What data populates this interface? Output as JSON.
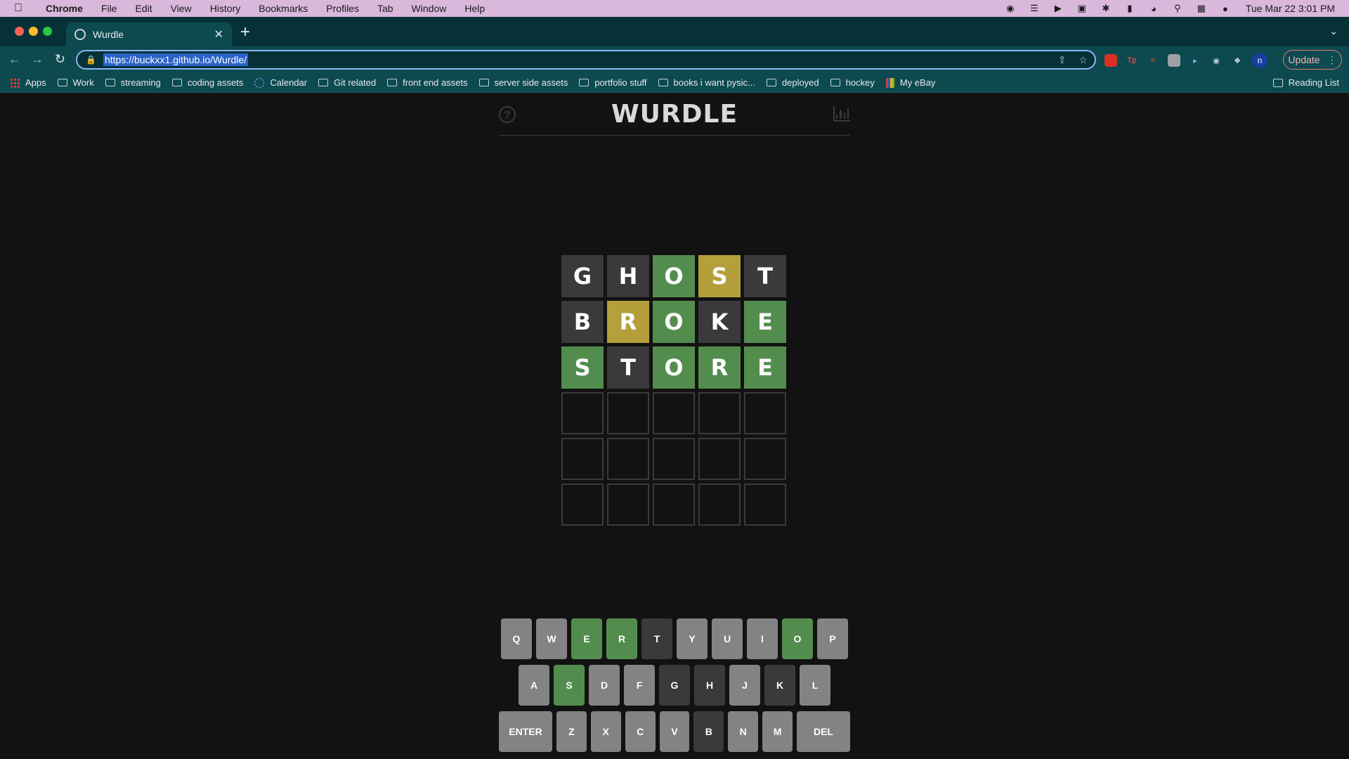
{
  "menubar": {
    "app": "Chrome",
    "items": [
      "File",
      "Edit",
      "View",
      "History",
      "Bookmarks",
      "Profiles",
      "Tab",
      "Window",
      "Help"
    ],
    "clock": "Tue Mar 22  3:01 PM"
  },
  "browser": {
    "tab_title": "Wurdle",
    "url": "https://buckxx1.github.io/Wurdle/",
    "update_label": "Update",
    "profile_initial": "n",
    "bookmarks": [
      {
        "label": "Apps",
        "icon": "apps-icon"
      },
      {
        "label": "Work",
        "icon": "folder-icon"
      },
      {
        "label": "streaming",
        "icon": "folder-icon"
      },
      {
        "label": "coding assets",
        "icon": "folder-icon"
      },
      {
        "label": "Calendar",
        "icon": "calendar-icon"
      },
      {
        "label": "Git related",
        "icon": "folder-icon"
      },
      {
        "label": "front end assets",
        "icon": "folder-icon"
      },
      {
        "label": "server side assets",
        "icon": "folder-icon"
      },
      {
        "label": "portfolio stuff",
        "icon": "folder-icon"
      },
      {
        "label": "books i want pysic...",
        "icon": "folder-icon"
      },
      {
        "label": "deployed",
        "icon": "folder-icon"
      },
      {
        "label": "hockey",
        "icon": "folder-icon"
      },
      {
        "label": "My eBay",
        "icon": "ebay-icon"
      }
    ],
    "reading_list": "Reading List"
  },
  "game": {
    "title": "WURDLE",
    "help_symbol": "?",
    "colors": {
      "correct": "#538d4e",
      "present": "#b59f3b",
      "absent": "#3a3a3c",
      "unused": "#818384"
    },
    "board": [
      [
        {
          "l": "G",
          "s": "absent"
        },
        {
          "l": "H",
          "s": "absent"
        },
        {
          "l": "O",
          "s": "correct"
        },
        {
          "l": "S",
          "s": "present"
        },
        {
          "l": "T",
          "s": "absent"
        }
      ],
      [
        {
          "l": "B",
          "s": "absent"
        },
        {
          "l": "R",
          "s": "present"
        },
        {
          "l": "O",
          "s": "correct"
        },
        {
          "l": "K",
          "s": "absent"
        },
        {
          "l": "E",
          "s": "correct"
        }
      ],
      [
        {
          "l": "S",
          "s": "correct"
        },
        {
          "l": "T",
          "s": "absent"
        },
        {
          "l": "O",
          "s": "correct"
        },
        {
          "l": "R",
          "s": "correct"
        },
        {
          "l": "E",
          "s": "correct"
        }
      ],
      [
        {
          "l": "",
          "s": "empty"
        },
        {
          "l": "",
          "s": "empty"
        },
        {
          "l": "",
          "s": "empty"
        },
        {
          "l": "",
          "s": "empty"
        },
        {
          "l": "",
          "s": "empty"
        }
      ],
      [
        {
          "l": "",
          "s": "empty"
        },
        {
          "l": "",
          "s": "empty"
        },
        {
          "l": "",
          "s": "empty"
        },
        {
          "l": "",
          "s": "empty"
        },
        {
          "l": "",
          "s": "empty"
        }
      ],
      [
        {
          "l": "",
          "s": "empty"
        },
        {
          "l": "",
          "s": "empty"
        },
        {
          "l": "",
          "s": "empty"
        },
        {
          "l": "",
          "s": "empty"
        },
        {
          "l": "",
          "s": "empty"
        }
      ]
    ],
    "keyboard": [
      [
        {
          "k": "Q",
          "s": "unused"
        },
        {
          "k": "W",
          "s": "unused"
        },
        {
          "k": "E",
          "s": "correct"
        },
        {
          "k": "R",
          "s": "correct"
        },
        {
          "k": "T",
          "s": "absent"
        },
        {
          "k": "Y",
          "s": "unused"
        },
        {
          "k": "U",
          "s": "unused"
        },
        {
          "k": "I",
          "s": "unused"
        },
        {
          "k": "O",
          "s": "correct"
        },
        {
          "k": "P",
          "s": "unused"
        }
      ],
      [
        {
          "k": "A",
          "s": "unused"
        },
        {
          "k": "S",
          "s": "correct"
        },
        {
          "k": "D",
          "s": "unused"
        },
        {
          "k": "F",
          "s": "unused"
        },
        {
          "k": "G",
          "s": "absent"
        },
        {
          "k": "H",
          "s": "absent"
        },
        {
          "k": "J",
          "s": "unused"
        },
        {
          "k": "K",
          "s": "absent"
        },
        {
          "k": "L",
          "s": "unused"
        }
      ],
      [
        {
          "k": "ENTER",
          "s": "unused",
          "wide": true
        },
        {
          "k": "Z",
          "s": "unused"
        },
        {
          "k": "X",
          "s": "unused"
        },
        {
          "k": "C",
          "s": "unused"
        },
        {
          "k": "V",
          "s": "unused"
        },
        {
          "k": "B",
          "s": "absent"
        },
        {
          "k": "N",
          "s": "unused"
        },
        {
          "k": "M",
          "s": "unused"
        },
        {
          "k": "DEL",
          "s": "unused",
          "wide": true
        }
      ]
    ]
  }
}
